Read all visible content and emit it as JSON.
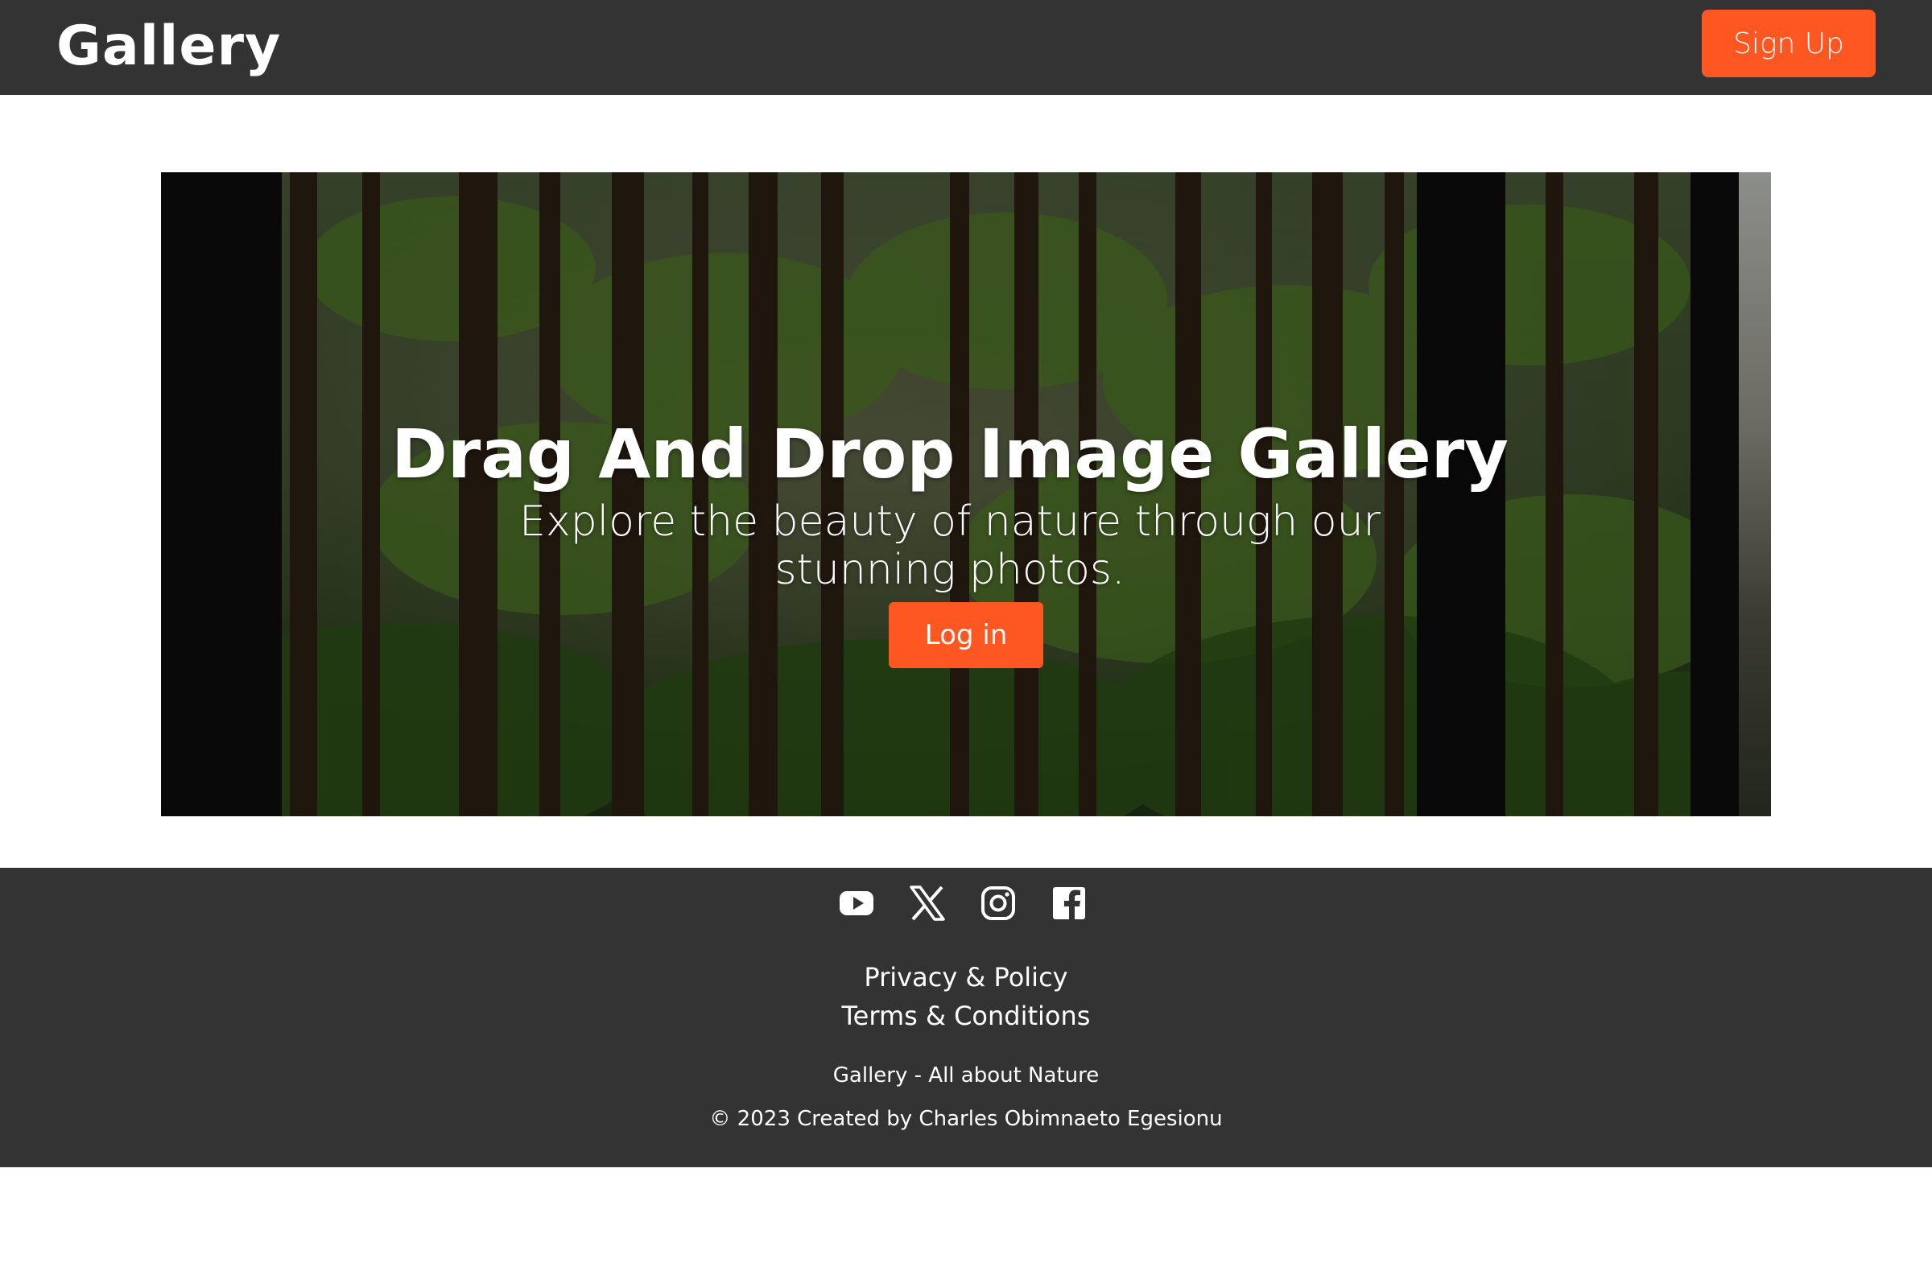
{
  "header": {
    "brand": "Gallery",
    "signup_label": "Sign Up"
  },
  "hero": {
    "title": "Drag And Drop Image Gallery",
    "subtitle": "Explore the beauty of nature through our stunning photos.",
    "login_label": "Log in"
  },
  "footer": {
    "social_icons": [
      "youtube-icon",
      "x-icon",
      "instagram-icon",
      "facebook-icon"
    ],
    "links": {
      "privacy": "Privacy & Policy",
      "terms": "Terms & Conditions"
    },
    "tagline": "Gallery - All about Nature",
    "copyright": "© 2023 Created by Charles Obimnaeto Egesionu"
  },
  "colors": {
    "navbar": "#333333",
    "accent": "#ff5722",
    "footer": "#333333",
    "text_light": "#ffffff"
  }
}
